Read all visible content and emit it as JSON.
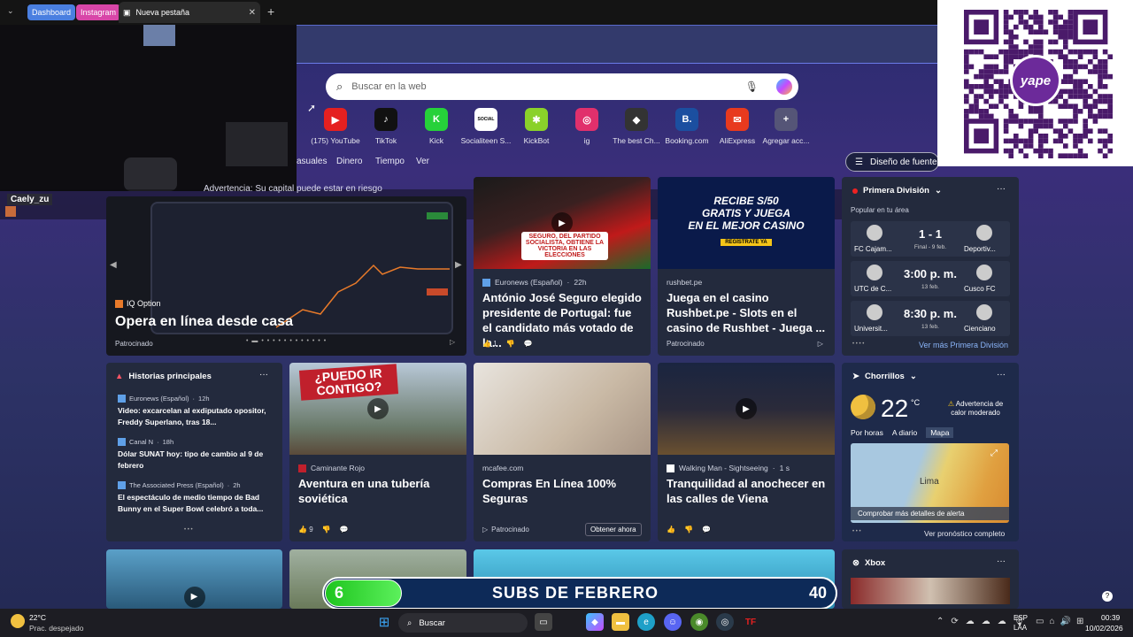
{
  "browser": {
    "tabs": [
      {
        "label": "Dashboard",
        "color": "#4a7fe0"
      },
      {
        "label": "Instagram",
        "color": "#d846a8"
      },
      {
        "label": "Nueva pestaña",
        "color": "#2a2a2a"
      }
    ]
  },
  "search": {
    "placeholder": "Buscar en la web"
  },
  "shortcuts": [
    {
      "label": "(175) YouTube",
      "glyph": "▶",
      "color": "#e52020"
    },
    {
      "label": "TikTok",
      "glyph": "♪",
      "color": "#111111"
    },
    {
      "label": "Kick",
      "glyph": "K",
      "color": "#26d13a"
    },
    {
      "label": "Socialiteen S...",
      "glyph": "SOCIAL",
      "color": "#ffffff"
    },
    {
      "label": "KickBot",
      "glyph": "✱",
      "color": "#8ad12a"
    },
    {
      "label": "ig",
      "glyph": "◎",
      "color": "#e1306c"
    },
    {
      "label": "The best Ch...",
      "glyph": "◆",
      "color": "#333333"
    },
    {
      "label": "Booking.com",
      "glyph": "B.",
      "color": "#1b4fa0"
    },
    {
      "label": "AliExpress",
      "glyph": "✉",
      "color": "#e83a1e"
    },
    {
      "label": "Agregar acc...",
      "glyph": "+",
      "color": "#555577"
    }
  ],
  "nav": {
    "items": [
      "asuales",
      "Dinero",
      "Tiempo",
      "Ver"
    ],
    "feed_design": "Diseño de fuente"
  },
  "stream": {
    "username": "Caely_zu"
  },
  "ad_main": {
    "warning": "Advertencia: Su capital puede estar en riesgo",
    "brand": "IQ Option",
    "title": "Opera en línea desde casa",
    "sponsored": "Patrocinado"
  },
  "news_top": [
    {
      "source": "Euronews (Español)",
      "age": "22h",
      "title": "António José Seguro elegido presidente de Portugal: fue el candidato más votado de la...",
      "likes": "1",
      "caption": "SEGURO, DEL PARTIDO SOCIALISTA, OBTIENE LA VICTORIA EN LAS ELECCIONES"
    },
    {
      "source": "rushbet.pe",
      "title": "Juega en el casino Rushbet.pe - Slots en el casino de Rushbet - Juega ...",
      "sponsored": "Patrocinado",
      "banner1": "RECIBE S/50",
      "banner2": "GRATIS Y JUEGA",
      "banner3": "EN EL MEJOR CASINO",
      "cta": "REGÍSTRATE YA"
    }
  ],
  "sports": {
    "league": "Primera División",
    "popular": "Popular en tu área",
    "matches": [
      {
        "home": "FC Cajam...",
        "away": "Deportiv...",
        "center": "1 - 1",
        "sub": "Final - 9 feb."
      },
      {
        "home": "UTC de C...",
        "away": "Cusco FC",
        "center": "3:00 p. m.",
        "sub": "13 feb."
      },
      {
        "home": "Universit...",
        "away": "Cienciano",
        "center": "8:30 p. m.",
        "sub": "13 feb."
      }
    ],
    "more": "Ver más Primera División"
  },
  "top_stories": {
    "header": "Historias principales",
    "items": [
      {
        "source": "Euronews (Español)",
        "age": "12h",
        "title": "Video: excarcelan al exdiputado opositor, Freddy Superlano, tras 18..."
      },
      {
        "source": "Canal N",
        "age": "18h",
        "title": "Dólar SUNAT hoy: tipo de cambio al 9 de febrero"
      },
      {
        "source": "The Associated Press (Español)",
        "age": "2h",
        "title": "El espectáculo de medio tiempo de Bad Bunny en el Super Bowl celebró a toda..."
      }
    ]
  },
  "news_mid": [
    {
      "source": "Caminante Rojo",
      "title": "Aventura en una tubería soviética",
      "likes": "9",
      "caption": "¿PUEDO IR CONTIGO?"
    },
    {
      "source": "mcafee.com",
      "title": "Compras En Línea 100% Seguras",
      "sponsored": "Patrocinado",
      "cta": "Obtener ahora"
    },
    {
      "source": "Walking Man - Sightseeing",
      "age": "1 s",
      "title": "Tranquilidad al anochecer en las calles de Viena"
    }
  ],
  "weather": {
    "location": "Chorrillos",
    "temp": "22",
    "unit": "°C",
    "alert": "Advertencia de calor moderado",
    "tabs": [
      "Por horas",
      "A diario",
      "Mapa"
    ],
    "map_city": "Lima",
    "map_link": "Comprobar más detalles de alerta",
    "forecast": "Ver pronóstico completo"
  },
  "xbox": {
    "label": "Xbox"
  },
  "subs_overlay": {
    "left": "6",
    "title": "SUBS DE FEBRERO",
    "right": "40",
    "progress_fraction": 0.15
  },
  "taskbar": {
    "temp": "22°C",
    "condition": "Prac. despejado",
    "search": "Buscar",
    "lang1": "ESP",
    "lang2": "LAA",
    "time": "00:39",
    "date": "10/02/2026"
  },
  "qr": {
    "brand": "yape"
  }
}
